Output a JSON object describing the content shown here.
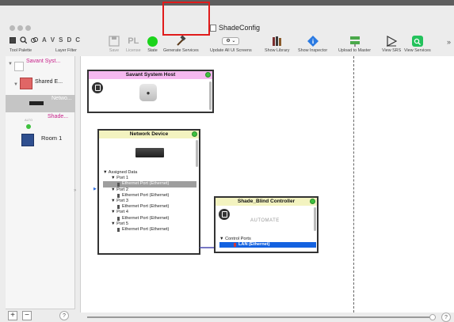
{
  "window": {
    "title": "ShadeConfig"
  },
  "toolbar": {
    "tool_letters": [
      "A",
      "V",
      "S",
      "D",
      "C"
    ],
    "pl_label": "PL",
    "left_labels": {
      "tool_palette": "Tool Palette",
      "layer_filter": "Layer Filter"
    },
    "buttons": [
      {
        "label": "Save",
        "icon": "save-icon",
        "enabled": false
      },
      {
        "label": "License",
        "icon": "license-icon",
        "enabled": false
      },
      {
        "label": "State",
        "icon": "state-green-circle-icon",
        "enabled": true
      },
      {
        "label": "Generate Services",
        "icon": "hammer-icon",
        "enabled": true
      },
      {
        "label": "Update All UI Screens",
        "icon": "gear-dropdown-icon",
        "enabled": true
      },
      {
        "label": "Show Library",
        "icon": "books-icon",
        "enabled": true
      },
      {
        "label": "Show Inspector",
        "icon": "info-diamond-icon",
        "enabled": true
      },
      {
        "label": "Upload to Master",
        "icon": "upload-network-icon",
        "enabled": true
      },
      {
        "label": "View SRS",
        "icon": "play-triangle-icon",
        "enabled": true
      },
      {
        "label": "View Services",
        "icon": "search-green-icon",
        "enabled": true
      }
    ],
    "overflow": "»"
  },
  "sidebar": {
    "items": [
      {
        "label": "Savant Syst...",
        "label_color": "#c8218a",
        "icon": "savant-host-icon",
        "selected": false
      },
      {
        "label": "Shared E...",
        "label_color": "#222222",
        "icon": "shared-equipment-icon",
        "selected": false
      },
      {
        "label": "Netwo...",
        "label_color": "#ffffff",
        "icon": "network-switch-icon",
        "selected": true
      },
      {
        "label": "Shade...",
        "label_color": "#c8218a",
        "icon": "shade-controller-icon",
        "selected": false
      },
      {
        "label": "Room 1",
        "label_color": "#222222",
        "icon": "room-icon",
        "selected": false
      }
    ],
    "footer": {
      "add": "+",
      "remove": "−",
      "help": "?"
    }
  },
  "canvas": {
    "host_card": {
      "title": "Savant System Host",
      "header_color": "#f5b8ef"
    },
    "network_card": {
      "title": "Network Device",
      "header_color": "#f3f3c0",
      "group_label": "Assigned Data",
      "ports": [
        {
          "name": "Port 1",
          "child": "Ethernet Port (Ethernet)",
          "highlighted": true
        },
        {
          "name": "Port 2",
          "child": "Ethernet Port (Ethernet)",
          "highlighted": false
        },
        {
          "name": "Port 3",
          "child": "Ethernet Port (Ethernet)",
          "highlighted": false
        },
        {
          "name": "Port 4",
          "child": "Ethernet Port (Ethernet)",
          "highlighted": false
        },
        {
          "name": "Port 5",
          "child": "Ethernet Port (Ethernet)",
          "highlighted": false
        }
      ]
    },
    "shade_card": {
      "title": "Shade_Blind Controller",
      "header_color": "#f3f3c0",
      "logo_text": "AUTOMATE",
      "group_label": "Control Ports",
      "port": "LAN (Ethernet)"
    },
    "help": "?"
  }
}
